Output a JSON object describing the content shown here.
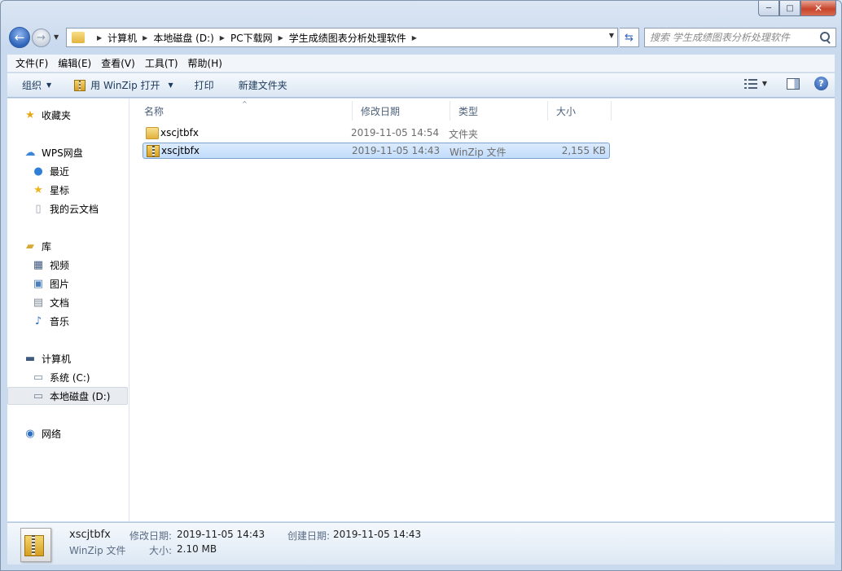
{
  "window": {
    "min_glyph": "─",
    "max_glyph": "□",
    "close_glyph": "✕"
  },
  "address": {
    "back_glyph": "←",
    "fwd_glyph": "→",
    "crumbs": [
      "计算机",
      "本地磁盘 (D:)",
      "PC下载网",
      "学生成绩图表分析处理软件"
    ],
    "refresh_glyph": "⇆"
  },
  "search": {
    "placeholder": "搜索 学生成绩图表分析处理软件"
  },
  "menu": [
    "文件(F)",
    "编辑(E)",
    "查看(V)",
    "工具(T)",
    "帮助(H)"
  ],
  "toolbar": {
    "organize": "组织",
    "open_with": "用 WinZip 打开",
    "print": "打印",
    "new_folder": "新建文件夹",
    "help": "?"
  },
  "nav": {
    "favorites": "收藏夹",
    "wps": "WPS网盘",
    "recent": "最近",
    "starred": "星标",
    "cloud_docs": "我的云文档",
    "libraries": "库",
    "videos": "视频",
    "pictures": "图片",
    "documents": "文档",
    "music": "音乐",
    "computer": "计算机",
    "drive_c": "系统 (C:)",
    "drive_d": "本地磁盘 (D:)",
    "network": "网络"
  },
  "columns": {
    "name": "名称",
    "date": "修改日期",
    "type": "类型",
    "size": "大小"
  },
  "files": [
    {
      "name": "xscjtbfx",
      "date": "2019-11-05 14:54",
      "type": "文件夹",
      "size": "",
      "icon": "folder-icon"
    },
    {
      "name": "xscjtbfx",
      "date": "2019-11-05 14:43",
      "type": "WinZip 文件",
      "size": "2,155 KB",
      "icon": "zip-icon"
    }
  ],
  "details": {
    "name": "xscjtbfx",
    "type": "WinZip 文件",
    "modified_label": "修改日期:",
    "modified": "2019-11-05 14:43",
    "created_label": "创建日期:",
    "created": "2019-11-05 14:43",
    "size_label": "大小:",
    "size": "2.10 MB"
  },
  "colors": {
    "accent": "#2f63b9",
    "selection": "#c1dcfc",
    "close": "#c7452b"
  }
}
